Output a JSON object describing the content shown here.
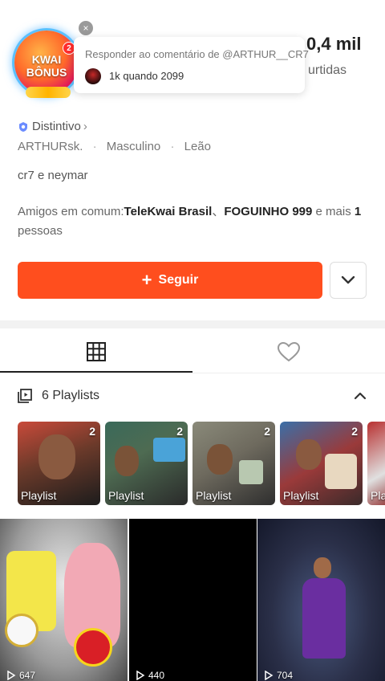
{
  "badge": {
    "line1": "KWAI",
    "line2": "BÔNUS",
    "count": "2",
    "close": "×"
  },
  "stats": {
    "value": "0,4 mil",
    "label": "urtidas"
  },
  "tooltip": {
    "title": "Responder ao comentário de @ARTHUR__CR7",
    "text": "1k quando 2099"
  },
  "profile": {
    "distintivo": "Distintivo",
    "chevron": "›",
    "tags": [
      "ARTHURsk.",
      "Masculino",
      "Leão"
    ],
    "separator": "·",
    "bio": "cr7 e neymar",
    "friends_prefix": "Amigos em comum:",
    "friend1": "TeleKwai Brasil",
    "friend_sep": "、",
    "friend2": "FOGUINHO 999",
    "friends_mid": " e mais ",
    "friends_count": "1",
    "friends_suffix": " pessoas"
  },
  "actions": {
    "follow_label": "Seguir",
    "follow_plus": "+",
    "dropdown_icon": "chevron-down-icon"
  },
  "tabs": [
    {
      "name": "grid-icon",
      "active": true
    },
    {
      "name": "heart-icon",
      "active": false
    }
  ],
  "playlists": {
    "header": "6 Playlists",
    "items": [
      {
        "count": "2",
        "label": "Playlist"
      },
      {
        "count": "2",
        "label": "Playlist"
      },
      {
        "count": "2",
        "label": "Playlist"
      },
      {
        "count": "2",
        "label": "Playlist"
      },
      {
        "count": "",
        "label": "Pla"
      }
    ]
  },
  "videos": [
    {
      "views": "647"
    },
    {
      "views": "440"
    },
    {
      "views": "704"
    }
  ],
  "colors": {
    "accent": "#ff4e1e",
    "text": "#222222",
    "muted": "#777777"
  }
}
